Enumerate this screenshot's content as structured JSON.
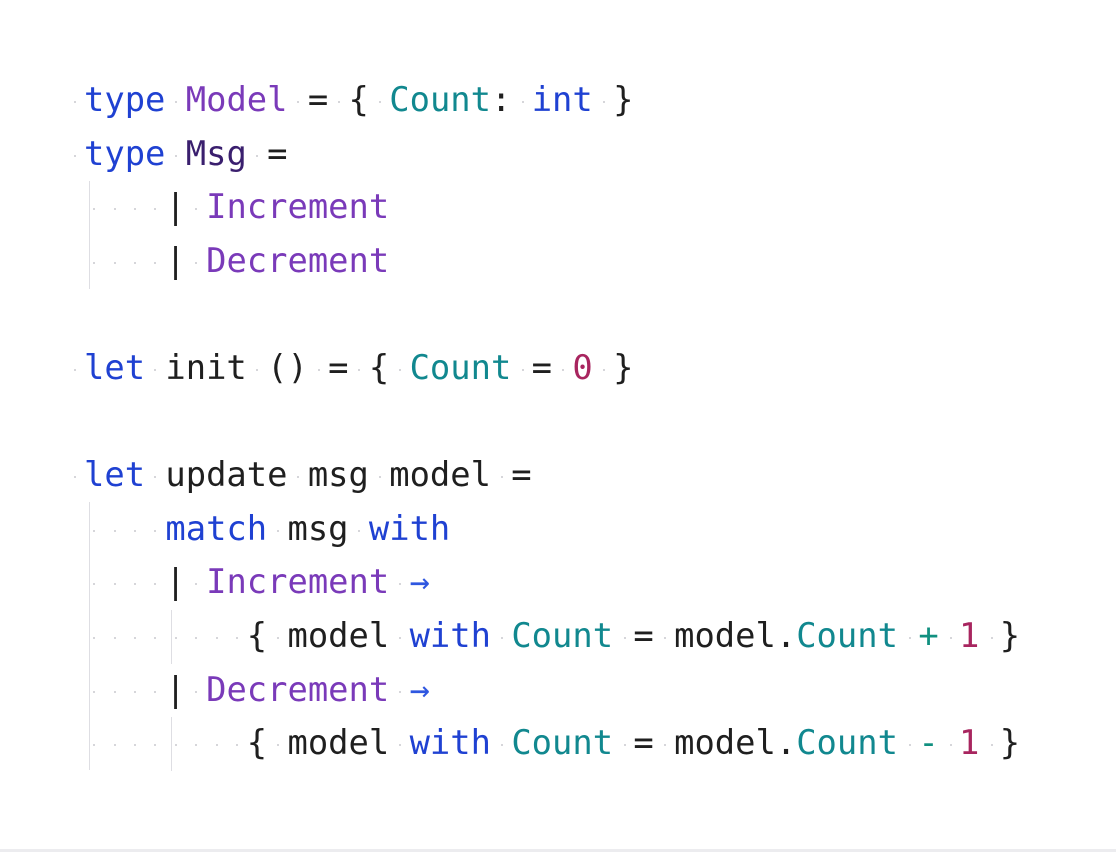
{
  "editor": {
    "language": "F#",
    "colors": {
      "keyword": "#1f41d2",
      "type": "#7a3ab9",
      "field": "#11888f",
      "number": "#a8255f",
      "text": "#1f1f1f"
    },
    "lines": [
      {
        "tokens": [
          {
            "text": "type",
            "kind": "keyword"
          },
          {
            "text": " ",
            "kind": "plain"
          },
          {
            "text": "Model",
            "kind": "type"
          },
          {
            "text": " = { ",
            "kind": "op"
          },
          {
            "text": "Count",
            "kind": "field"
          },
          {
            "text": ": ",
            "kind": "op"
          },
          {
            "text": "int",
            "kind": "keyword"
          },
          {
            "text": " }",
            "kind": "op"
          }
        ]
      },
      {
        "tokens": [
          {
            "text": "type",
            "kind": "keyword"
          },
          {
            "text": " ",
            "kind": "plain"
          },
          {
            "text": "Msg",
            "kind": "type-dark"
          },
          {
            "text": " =",
            "kind": "op"
          }
        ]
      },
      {
        "tokens": [
          {
            "text": "    | ",
            "kind": "op"
          },
          {
            "text": "Increment",
            "kind": "case"
          }
        ]
      },
      {
        "tokens": [
          {
            "text": "    | ",
            "kind": "op"
          },
          {
            "text": "Decrement",
            "kind": "case"
          }
        ]
      },
      {
        "tokens": []
      },
      {
        "tokens": [
          {
            "text": "let",
            "kind": "keyword"
          },
          {
            "text": " init () = { ",
            "kind": "plain"
          },
          {
            "text": "Count",
            "kind": "field"
          },
          {
            "text": " = ",
            "kind": "op"
          },
          {
            "text": "0",
            "kind": "number"
          },
          {
            "text": " }",
            "kind": "op"
          }
        ]
      },
      {
        "tokens": []
      },
      {
        "tokens": [
          {
            "text": "let",
            "kind": "keyword"
          },
          {
            "text": " update msg model =",
            "kind": "plain"
          }
        ]
      },
      {
        "tokens": [
          {
            "text": "    ",
            "kind": "plain"
          },
          {
            "text": "match",
            "kind": "keyword"
          },
          {
            "text": " msg ",
            "kind": "plain"
          },
          {
            "text": "with",
            "kind": "keyword"
          }
        ]
      },
      {
        "tokens": [
          {
            "text": "    | ",
            "kind": "op"
          },
          {
            "text": "Increment",
            "kind": "case"
          },
          {
            "text": " ",
            "kind": "plain"
          },
          {
            "text": "→",
            "kind": "arrow"
          }
        ]
      },
      {
        "tokens": [
          {
            "text": "        { model ",
            "kind": "plain"
          },
          {
            "text": "with",
            "kind": "keyword"
          },
          {
            "text": " ",
            "kind": "plain"
          },
          {
            "text": "Count",
            "kind": "field"
          },
          {
            "text": " = model.",
            "kind": "plain"
          },
          {
            "text": "Count",
            "kind": "field"
          },
          {
            "text": " ",
            "kind": "plain"
          },
          {
            "text": "+",
            "kind": "op-green"
          },
          {
            "text": " ",
            "kind": "plain"
          },
          {
            "text": "1",
            "kind": "number"
          },
          {
            "text": " }",
            "kind": "op"
          }
        ]
      },
      {
        "tokens": [
          {
            "text": "    | ",
            "kind": "op"
          },
          {
            "text": "Decrement",
            "kind": "case"
          },
          {
            "text": " ",
            "kind": "plain"
          },
          {
            "text": "→",
            "kind": "arrow"
          }
        ]
      },
      {
        "tokens": [
          {
            "text": "        { model ",
            "kind": "plain"
          },
          {
            "text": "with",
            "kind": "keyword"
          },
          {
            "text": " ",
            "kind": "plain"
          },
          {
            "text": "Count",
            "kind": "field"
          },
          {
            "text": " = model.",
            "kind": "plain"
          },
          {
            "text": "Count",
            "kind": "field"
          },
          {
            "text": " ",
            "kind": "plain"
          },
          {
            "text": "-",
            "kind": "op-green"
          },
          {
            "text": " ",
            "kind": "plain"
          },
          {
            "text": "1",
            "kind": "number"
          },
          {
            "text": " }",
            "kind": "op"
          }
        ]
      }
    ]
  }
}
